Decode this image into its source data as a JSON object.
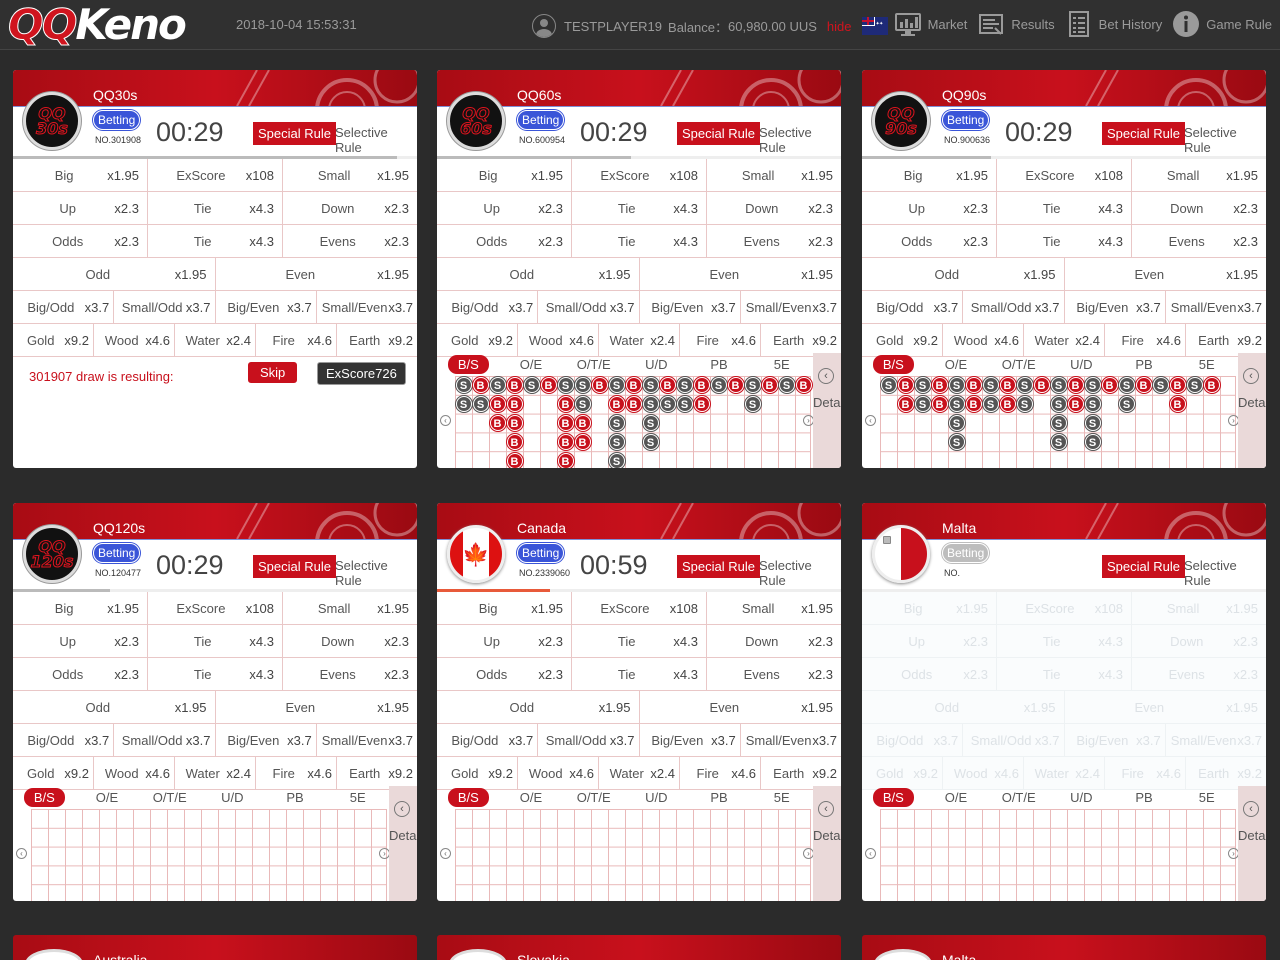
{
  "header": {
    "logo_qq": "QQ",
    "logo_keno": "Keno",
    "datetime": "2018-10-04 15:53:31",
    "username": "TESTPLAYER19",
    "balance_label": "Balance：",
    "balance_value": "60,980.00 UUS",
    "hide_label": "hide",
    "flag_icon": "australia-flag-icon",
    "nav": [
      {
        "label": "Market",
        "icon": "market-chart-icon"
      },
      {
        "label": "Results",
        "icon": "results-list-icon"
      },
      {
        "label": "Bet History",
        "icon": "bet-history-icon"
      },
      {
        "label": "Game Rule",
        "icon": "info-icon"
      }
    ]
  },
  "odds_rows": {
    "row1": [
      [
        "Big",
        "x1.95"
      ],
      [
        "ExScore",
        "x108"
      ],
      [
        "Small",
        "x1.95"
      ]
    ],
    "row2": [
      [
        "Up",
        "x2.3"
      ],
      [
        "Tie",
        "x4.3"
      ],
      [
        "Down",
        "x2.3"
      ]
    ],
    "row3": [
      [
        "Odds",
        "x2.3"
      ],
      [
        "Tie",
        "x4.3"
      ],
      [
        "Evens",
        "x2.3"
      ]
    ],
    "row4": [
      [
        "Odd",
        "x1.95"
      ],
      [
        "Even",
        "x1.95"
      ]
    ],
    "row5": [
      [
        "Big/Odd",
        "x3.7"
      ],
      [
        "Small/Odd",
        "x3.7"
      ],
      [
        "Big/Even",
        "x3.7"
      ],
      [
        "Small/Even",
        "x3.7"
      ]
    ],
    "row6": [
      [
        "Gold",
        "x9.2"
      ],
      [
        "Wood",
        "x4.6"
      ],
      [
        "Water",
        "x2.4"
      ],
      [
        "Fire",
        "x4.6"
      ],
      [
        "Earth",
        "x9.2"
      ]
    ]
  },
  "tabs": [
    "B/S",
    "O/E",
    "O/T/E",
    "U/D",
    "PB",
    "5E"
  ],
  "detail_label": "Detail",
  "special_rule": "Special Rule",
  "selective_rule": "Selective Rule",
  "betting_label": "Betting",
  "panels": [
    {
      "title": "QQ30s",
      "badge": "QQ\n30s",
      "badge_l1": "QQ",
      "badge_l2": "30s",
      "no": "NO.301908",
      "timer": "00:29",
      "progress": 0.95,
      "result_text": "301907 draw is resulting:",
      "skip": "Skip",
      "exscore": "ExScore726"
    },
    {
      "title": "QQ60s",
      "badge_l1": "QQ",
      "badge_l2": "60s",
      "no": "NO.600954",
      "timer": "00:29",
      "progress": 0.48
    },
    {
      "title": "QQ90s",
      "badge_l1": "QQ",
      "badge_l2": "90s",
      "no": "NO.900636",
      "timer": "00:29",
      "progress": 0.32
    },
    {
      "title": "QQ120s",
      "badge_l1": "QQ",
      "badge_l2": "120s",
      "no": "NO.120477",
      "timer": "00:29",
      "progress": 0.24
    },
    {
      "title": "Canada",
      "no": "NO.2339060",
      "timer": "00:59",
      "progress": 0.28
    },
    {
      "title": "Malta",
      "no": "NO.",
      "timer": ""
    }
  ],
  "bs_road_60": [
    [
      "S",
      "S"
    ],
    [
      "B",
      "S"
    ],
    [
      "S",
      "B",
      "B"
    ],
    [
      "B",
      "B",
      "B",
      "B",
      "B"
    ],
    [
      "S"
    ],
    [
      "B"
    ],
    [
      "S",
      "B",
      "B",
      "B",
      "B",
      "B"
    ],
    [
      "S",
      "S",
      "B",
      "B"
    ],
    [
      "B"
    ],
    [
      "S",
      "B",
      "S",
      "S",
      "S"
    ],
    [
      "B",
      "B"
    ],
    [
      "S",
      "S",
      "S",
      "S"
    ],
    [
      "B",
      "S"
    ],
    [
      "S",
      "S"
    ],
    [
      "B",
      "B"
    ],
    [
      "S"
    ],
    [
      "B"
    ],
    [
      "S",
      "S"
    ],
    [
      "B"
    ],
    [
      "S"
    ],
    [
      "B"
    ]
  ],
  "bs_road_90": [
    [
      "S"
    ],
    [
      "B",
      "B"
    ],
    [
      "S",
      "S"
    ],
    [
      "B",
      "B"
    ],
    [
      "S",
      "S",
      "S",
      "S"
    ],
    [
      "B",
      "B"
    ],
    [
      "S",
      "S"
    ],
    [
      "B",
      "B"
    ],
    [
      "S",
      "S"
    ],
    [
      "B"
    ],
    [
      "S",
      "S",
      "S",
      "S"
    ],
    [
      "B",
      "B"
    ],
    [
      "S",
      "S",
      "S",
      "S"
    ],
    [
      "B"
    ],
    [
      "S",
      "S"
    ],
    [
      "B"
    ],
    [
      "S"
    ],
    [
      "B",
      "B"
    ],
    [
      "S"
    ],
    [
      "B"
    ]
  ],
  "bottom_titles": [
    "Australia",
    "Slovakia",
    "Malta"
  ]
}
